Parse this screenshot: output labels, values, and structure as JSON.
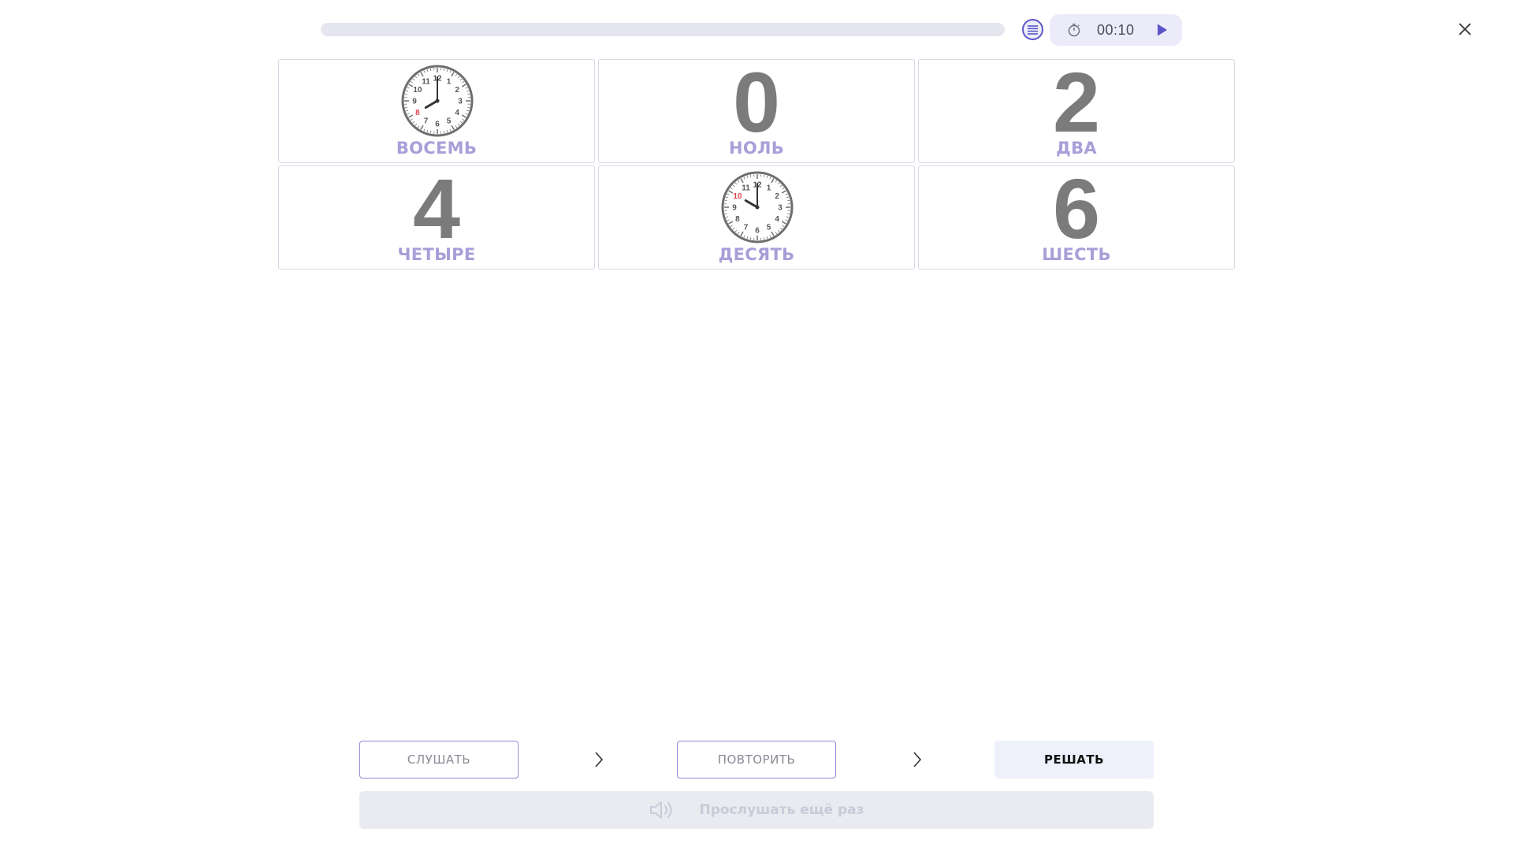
{
  "topbar": {
    "progress_percent": 0,
    "list_icon": "list-icon",
    "timer_icon": "stopwatch-icon",
    "timer_text": "00:10",
    "play_icon": "play-icon",
    "close_icon": "close-icon",
    "accent_color": "#5b55c9"
  },
  "cards": [
    {
      "kind": "clock",
      "word": "ВОСЕМЬ",
      "hour": 8,
      "highlight_label": "8"
    },
    {
      "kind": "digit",
      "digit": "0",
      "word": "НОЛЬ"
    },
    {
      "kind": "digit",
      "digit": "2",
      "word": "ДВА"
    },
    {
      "kind": "digit",
      "digit": "4",
      "word": "ЧЕТЫРЕ"
    },
    {
      "kind": "clock",
      "word": "ДЕСЯТЬ",
      "hour": 10,
      "highlight_label": "10"
    },
    {
      "kind": "digit",
      "digit": "6",
      "word": "ШЕСТЬ"
    }
  ],
  "steps": {
    "listen": "СЛУШАТЬ",
    "repeat": "ПОВТОРИТЬ",
    "solve": "РЕШАТЬ"
  },
  "listen_again": {
    "icon": "speaker-icon",
    "label": "Прослушать ещё раз"
  }
}
